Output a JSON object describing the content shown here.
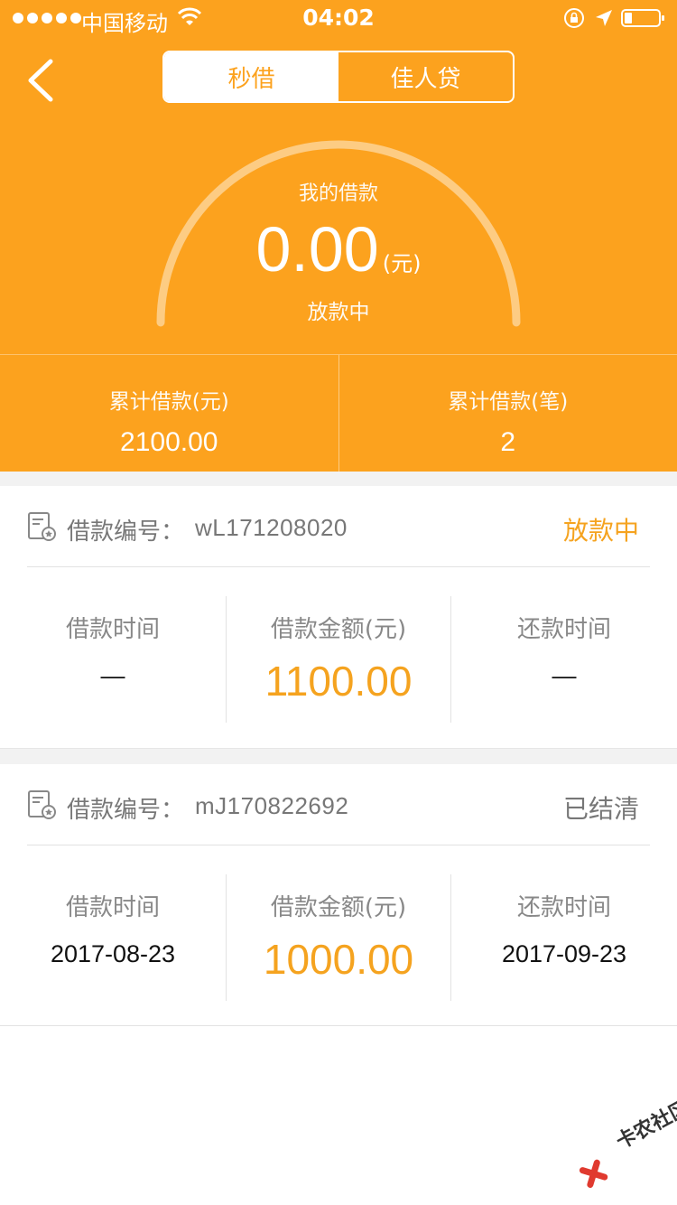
{
  "status_bar": {
    "carrier": "中国移动",
    "time": "04:02"
  },
  "tabs": [
    {
      "label": "秒借",
      "active": true
    },
    {
      "label": "佳人贷",
      "active": false
    }
  ],
  "summary": {
    "label": "我的借款",
    "amount": "0.00",
    "unit": "(元)",
    "status": "放款中"
  },
  "stats": [
    {
      "label": "累计借款(元)",
      "value": "2100.00"
    },
    {
      "label": "累计借款(笔)",
      "value": "2"
    }
  ],
  "loans": [
    {
      "no_label": "借款编号：",
      "no_value": "wL171208020",
      "status": "放款中",
      "status_color": "#F5A31F",
      "borrow_time_label": "借款时间",
      "borrow_time": "—",
      "amount_label": "借款金额(元)",
      "amount": "1100.00",
      "repay_time_label": "还款时间",
      "repay_time": "—"
    },
    {
      "no_label": "借款编号：",
      "no_value": "mJ170822692",
      "status": "已结清",
      "status_color": "#777777",
      "borrow_time_label": "借款时间",
      "borrow_time": "2017-08-23",
      "amount_label": "借款金额(元)",
      "amount": "1000.00",
      "repay_time_label": "还款时间",
      "repay_time": "2017-09-23"
    }
  ],
  "watermark": "卡农社区",
  "colors": {
    "accent": "#FCA21E",
    "amount": "#F5A31F"
  }
}
